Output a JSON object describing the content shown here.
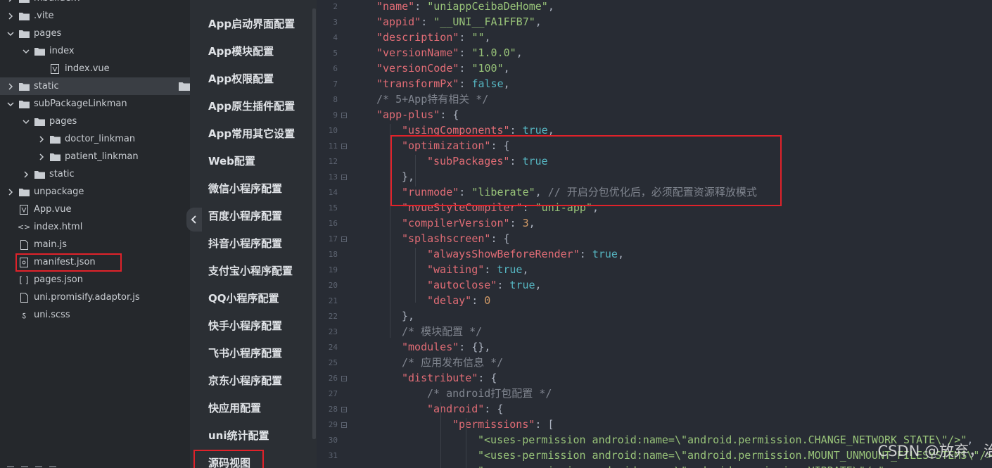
{
  "file_tree": [
    {
      "name": "mbuilderx",
      "type": "folder",
      "expanded": false
    },
    {
      "name": ".vite",
      "type": "folder",
      "expanded": false
    },
    {
      "name": "pages",
      "type": "folder",
      "expanded": true
    },
    {
      "name": "index",
      "type": "folder",
      "expanded": true
    },
    {
      "name": "index.vue",
      "type": "vue-file"
    },
    {
      "name": "static",
      "type": "folder",
      "expanded": false,
      "selected": true
    },
    {
      "name": "subPackageLinkman",
      "type": "folder",
      "expanded": true
    },
    {
      "name": "pages",
      "type": "folder",
      "expanded": true
    },
    {
      "name": "doctor_linkman",
      "type": "folder",
      "expanded": false
    },
    {
      "name": "patient_linkman",
      "type": "folder",
      "expanded": false
    },
    {
      "name": "static",
      "type": "folder",
      "expanded": false
    },
    {
      "name": "unpackage",
      "type": "folder",
      "expanded": false
    },
    {
      "name": "App.vue",
      "type": "vue-file"
    },
    {
      "name": "index.html",
      "type": "html-file"
    },
    {
      "name": "main.js",
      "type": "js-file"
    },
    {
      "name": "manifest.json",
      "type": "json-config-file",
      "active": true
    },
    {
      "name": "pages.json",
      "type": "json-file"
    },
    {
      "name": "uni.promisify.adaptor.js",
      "type": "js-file"
    },
    {
      "name": "uni.scss",
      "type": "scss-file"
    }
  ],
  "settings_nav": [
    "App启动界面配置",
    "App模块配置",
    "App权限配置",
    "App原生插件配置",
    "App常用其它设置",
    "Web配置",
    "微信小程序配置",
    "百度小程序配置",
    "抖音小程序配置",
    "支付宝小程序配置",
    "QQ小程序配置",
    "快手小程序配置",
    "飞书小程序配置",
    "京东小程序配置",
    "快应用配置",
    "uni统计配置",
    "源码视图"
  ],
  "code": [
    {
      "num": "2",
      "fold": false,
      "indent": 1,
      "tokens": [
        [
          "k",
          "\"name\""
        ],
        [
          "p",
          ": "
        ],
        [
          "s",
          "\"uniappCeibaDeHome\""
        ],
        [
          "p",
          ","
        ]
      ]
    },
    {
      "num": "3",
      "fold": false,
      "indent": 1,
      "tokens": [
        [
          "k",
          "\"appid\""
        ],
        [
          "p",
          ": "
        ],
        [
          "s",
          "\"__UNI__FA1FFB7\""
        ],
        [
          "p",
          ","
        ]
      ]
    },
    {
      "num": "4",
      "fold": false,
      "indent": 1,
      "tokens": [
        [
          "k",
          "\"description\""
        ],
        [
          "p",
          ": "
        ],
        [
          "s",
          "\"\""
        ],
        [
          "p",
          ","
        ]
      ]
    },
    {
      "num": "5",
      "fold": false,
      "indent": 1,
      "tokens": [
        [
          "k",
          "\"versionName\""
        ],
        [
          "p",
          ": "
        ],
        [
          "s",
          "\"1.0.0\""
        ],
        [
          "p",
          ","
        ]
      ]
    },
    {
      "num": "6",
      "fold": false,
      "indent": 1,
      "tokens": [
        [
          "k",
          "\"versionCode\""
        ],
        [
          "p",
          ": "
        ],
        [
          "s",
          "\"100\""
        ],
        [
          "p",
          ","
        ]
      ]
    },
    {
      "num": "7",
      "fold": false,
      "indent": 1,
      "tokens": [
        [
          "k",
          "\"transformPx\""
        ],
        [
          "p",
          ": "
        ],
        [
          "b",
          "false"
        ],
        [
          "p",
          ","
        ]
      ]
    },
    {
      "num": "8",
      "fold": false,
      "indent": 1,
      "tokens": [
        [
          "c",
          "/* 5+App特有相关 */"
        ]
      ]
    },
    {
      "num": "9",
      "fold": true,
      "indent": 1,
      "tokens": [
        [
          "k",
          "\"app-plus\""
        ],
        [
          "p",
          ": {"
        ]
      ]
    },
    {
      "num": "10",
      "fold": false,
      "indent": 2,
      "tokens": [
        [
          "k",
          "\"usingComponents\""
        ],
        [
          "p",
          ": "
        ],
        [
          "b",
          "true"
        ],
        [
          "p",
          ","
        ]
      ]
    },
    {
      "num": "11",
      "fold": true,
      "indent": 2,
      "tokens": [
        [
          "k",
          "\"optimization\""
        ],
        [
          "p",
          ": {"
        ]
      ]
    },
    {
      "num": "12",
      "fold": false,
      "indent": 3,
      "tokens": [
        [
          "k",
          "\"subPackages\""
        ],
        [
          "p",
          ": "
        ],
        [
          "b",
          "true"
        ]
      ]
    },
    {
      "num": "13",
      "fold": true,
      "indent": 2,
      "tokens": [
        [
          "p",
          "},"
        ]
      ]
    },
    {
      "num": "14",
      "fold": false,
      "indent": 2,
      "tokens": [
        [
          "k",
          "\"runmode\""
        ],
        [
          "p",
          ": "
        ],
        [
          "s",
          "\"liberate\""
        ],
        [
          "p",
          ", "
        ],
        [
          "c",
          "// 开启分包优化后，必须配置资源释放模式"
        ]
      ]
    },
    {
      "num": "15",
      "fold": false,
      "indent": 2,
      "tokens": [
        [
          "k",
          "\"nvueStyleCompiler\""
        ],
        [
          "p",
          ": "
        ],
        [
          "s",
          "\"uni-app\""
        ],
        [
          "p",
          ","
        ]
      ]
    },
    {
      "num": "16",
      "fold": false,
      "indent": 2,
      "tokens": [
        [
          "k",
          "\"compilerVersion\""
        ],
        [
          "p",
          ": "
        ],
        [
          "n",
          "3"
        ],
        [
          "p",
          ","
        ]
      ]
    },
    {
      "num": "17",
      "fold": true,
      "indent": 2,
      "tokens": [
        [
          "k",
          "\"splashscreen\""
        ],
        [
          "p",
          ": {"
        ]
      ]
    },
    {
      "num": "18",
      "fold": false,
      "indent": 3,
      "tokens": [
        [
          "k",
          "\"alwaysShowBeforeRender\""
        ],
        [
          "p",
          ": "
        ],
        [
          "b",
          "true"
        ],
        [
          "p",
          ","
        ]
      ]
    },
    {
      "num": "19",
      "fold": false,
      "indent": 3,
      "tokens": [
        [
          "k",
          "\"waiting\""
        ],
        [
          "p",
          ": "
        ],
        [
          "b",
          "true"
        ],
        [
          "p",
          ","
        ]
      ]
    },
    {
      "num": "20",
      "fold": false,
      "indent": 3,
      "tokens": [
        [
          "k",
          "\"autoclose\""
        ],
        [
          "p",
          ": "
        ],
        [
          "b",
          "true"
        ],
        [
          "p",
          ","
        ]
      ]
    },
    {
      "num": "21",
      "fold": false,
      "indent": 3,
      "tokens": [
        [
          "k",
          "\"delay\""
        ],
        [
          "p",
          ": "
        ],
        [
          "n",
          "0"
        ]
      ]
    },
    {
      "num": "22",
      "fold": false,
      "indent": 2,
      "tokens": [
        [
          "p",
          "},"
        ]
      ]
    },
    {
      "num": "23",
      "fold": false,
      "indent": 2,
      "tokens": [
        [
          "c",
          "/* 模块配置 */"
        ]
      ]
    },
    {
      "num": "24",
      "fold": false,
      "indent": 2,
      "tokens": [
        [
          "k",
          "\"modules\""
        ],
        [
          "p",
          ": {},"
        ]
      ]
    },
    {
      "num": "25",
      "fold": false,
      "indent": 2,
      "tokens": [
        [
          "c",
          "/* 应用发布信息 */"
        ]
      ]
    },
    {
      "num": "26",
      "fold": true,
      "indent": 2,
      "tokens": [
        [
          "k",
          "\"distribute\""
        ],
        [
          "p",
          ": {"
        ]
      ]
    },
    {
      "num": "27",
      "fold": false,
      "indent": 3,
      "tokens": [
        [
          "c",
          "/* android打包配置 */"
        ]
      ]
    },
    {
      "num": "28",
      "fold": true,
      "indent": 3,
      "tokens": [
        [
          "k",
          "\"android\""
        ],
        [
          "p",
          ": {"
        ]
      ]
    },
    {
      "num": "29",
      "fold": true,
      "indent": 4,
      "tokens": [
        [
          "k",
          "\"permissions\""
        ],
        [
          "p",
          ": ["
        ]
      ]
    },
    {
      "num": "30",
      "fold": false,
      "indent": 5,
      "tokens": [
        [
          "s",
          "\"<uses-permission android:name=\\\"android.permission.CHANGE_NETWORK_STATE\\\"/>\""
        ],
        [
          "p",
          ","
        ]
      ]
    },
    {
      "num": "31",
      "fold": false,
      "indent": 5,
      "tokens": [
        [
          "s",
          "\"<uses-permission android:name=\\\"android.permission.MOUNT_UNMOUNT_FILESYSTEMS\\\"/>\""
        ],
        [
          "p",
          ","
        ]
      ]
    },
    {
      "num": "32",
      "fold": false,
      "indent": 5,
      "tokens": [
        [
          "s",
          "\"<uses-permission android:name=\\\"android.permission.VIBRATE\\\"/>\""
        ],
        [
          "p",
          ","
        ]
      ]
    }
  ],
  "watermark": "CSDN @放弃，治疗",
  "colors": {
    "annotation_red": "#e0222a",
    "key": "#e06c75",
    "string": "#98c379",
    "number": "#d19a66",
    "boolean": "#56b6c2",
    "comment": "#7f848e"
  }
}
